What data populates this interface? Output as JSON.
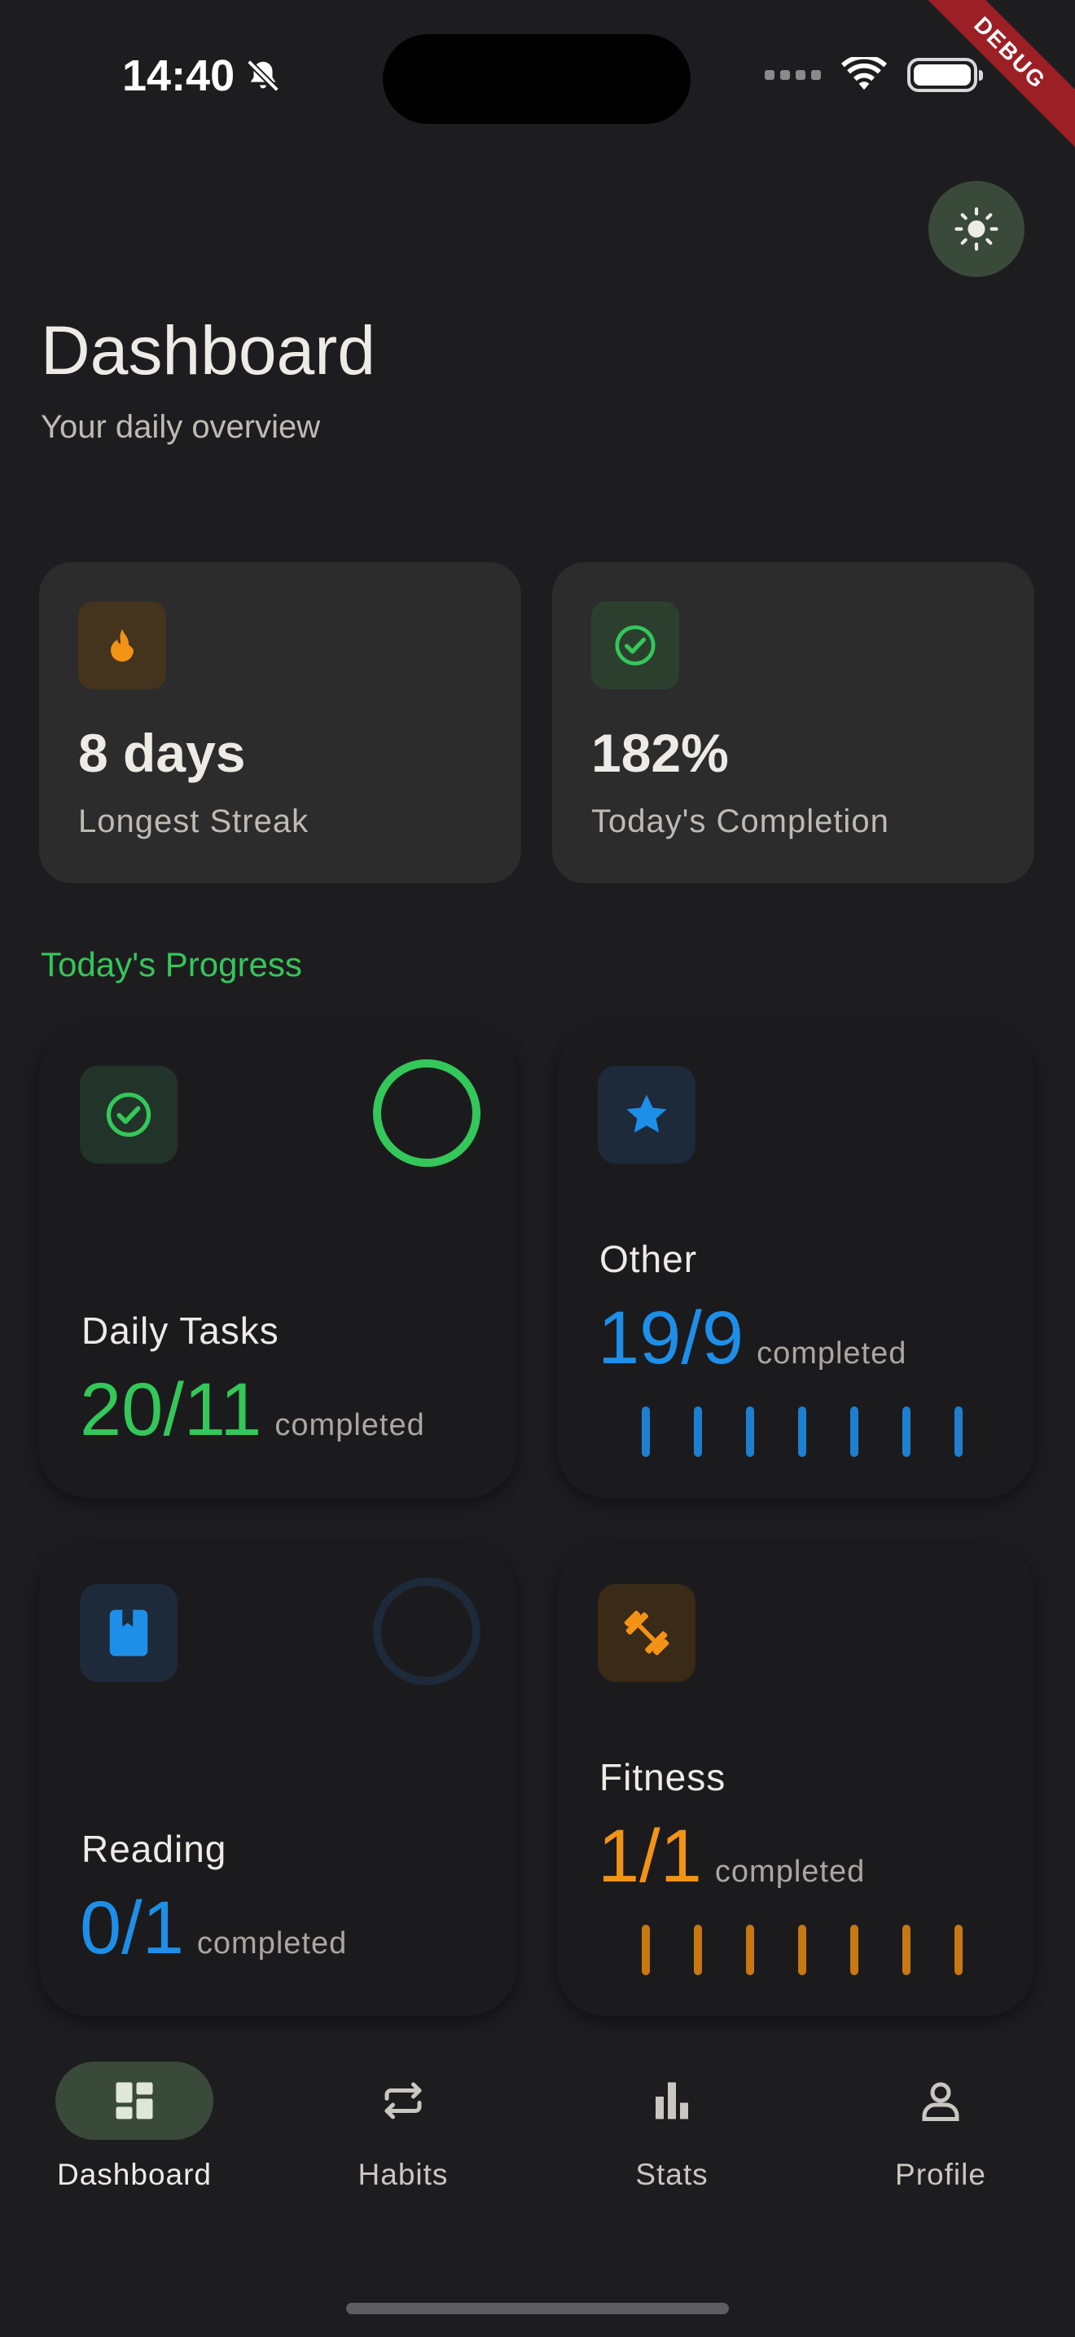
{
  "status_bar": {
    "time": "14:40",
    "debug_label": "DEBUG"
  },
  "header": {
    "title": "Dashboard",
    "subtitle": "Your daily overview"
  },
  "stats": [
    {
      "value": "8 days",
      "label": "Longest Streak",
      "icon": "flame-icon"
    },
    {
      "value": "182%",
      "label": "Today's Completion",
      "icon": "check-circle-icon"
    }
  ],
  "section_title": "Today's Progress",
  "progress": [
    {
      "name": "Daily Tasks",
      "count": "20/11",
      "unit": "completed",
      "color": "#34c759",
      "icon": "check-circle-icon",
      "ring": "complete"
    },
    {
      "name": "Other",
      "count": "19/9",
      "unit": "completed",
      "color": "#1e8fe8",
      "icon": "star-icon",
      "weekly_bars": 7
    },
    {
      "name": "Reading",
      "count": "0/1",
      "unit": "completed",
      "color": "#1e8fe8",
      "icon": "book-icon",
      "ring": "empty"
    },
    {
      "name": "Fitness",
      "count": "1/1",
      "unit": "completed",
      "color": "#f39316",
      "icon": "dumbbell-icon",
      "weekly_bars": 7
    }
  ],
  "nav": [
    {
      "label": "Dashboard",
      "icon": "dashboard-icon",
      "active": true
    },
    {
      "label": "Habits",
      "icon": "repeat-icon",
      "active": false
    },
    {
      "label": "Stats",
      "icon": "bar-chart-icon",
      "active": false
    },
    {
      "label": "Profile",
      "icon": "person-icon",
      "active": false
    }
  ],
  "colors": {
    "accent": "#34c759",
    "blue": "#1e8fe8",
    "orange": "#f39316",
    "background": "#1d1d1f"
  }
}
